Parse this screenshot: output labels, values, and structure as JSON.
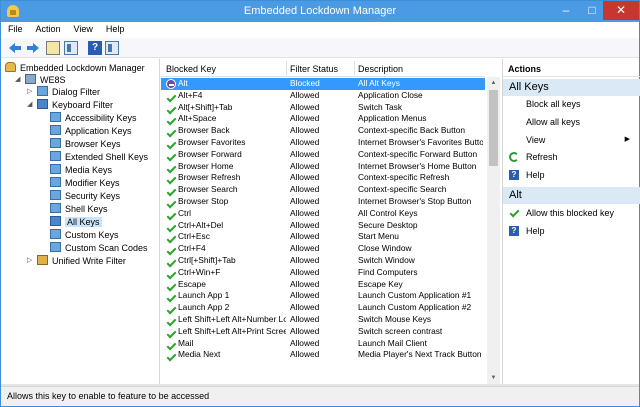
{
  "window": {
    "title": "Embedded Lockdown Manager",
    "controls": {
      "minimize": "–",
      "maximize": "□",
      "close": "✕"
    }
  },
  "menu": [
    "File",
    "Action",
    "View",
    "Help"
  ],
  "toolbar": {
    "icons": [
      "back-arrow-icon",
      "forward-arrow-icon",
      "up-folder-icon",
      "show-hide-tree-icon",
      "help-icon",
      "show-hide-action-pane-icon"
    ],
    "help_glyph": "?"
  },
  "tree": {
    "root": "Embedded Lockdown Manager",
    "device": "WE8S",
    "dialog_filter": "Dialog Filter",
    "keyboard_filter": "Keyboard Filter",
    "keyboard_children": [
      "Accessibility Keys",
      "Application Keys",
      "Browser Keys",
      "Extended Shell Keys",
      "Media Keys",
      "Modifier Keys",
      "Security Keys",
      "Shell Keys",
      "All Keys",
      "Custom Keys",
      "Custom Scan Codes"
    ],
    "selected": "All Keys",
    "uwf": "Unified Write Filter",
    "expander_open": "◢",
    "expander_closed": "▷"
  },
  "list": {
    "columns": [
      "Blocked Key",
      "Filter Status",
      "Description"
    ],
    "rows": [
      {
        "key": "Alt",
        "status": "Blocked",
        "desc": "All Alt Keys",
        "blocked": true
      },
      {
        "key": "Alt+F4",
        "status": "Allowed",
        "desc": "Application Close"
      },
      {
        "key": "Alt[+Shift]+Tab",
        "status": "Allowed",
        "desc": "Switch Task"
      },
      {
        "key": "Alt+Space",
        "status": "Allowed",
        "desc": "Application Menus"
      },
      {
        "key": "Browser Back",
        "status": "Allowed",
        "desc": "Context-specific Back Button"
      },
      {
        "key": "Browser Favorites",
        "status": "Allowed",
        "desc": "Internet Browser's Favorites Button"
      },
      {
        "key": "Browser Forward",
        "status": "Allowed",
        "desc": "Context-specific Forward Button"
      },
      {
        "key": "Browser Home",
        "status": "Allowed",
        "desc": "Internet Browser's Home Button"
      },
      {
        "key": "Browser Refresh",
        "status": "Allowed",
        "desc": "Context-specific Refresh"
      },
      {
        "key": "Browser Search",
        "status": "Allowed",
        "desc": "Context-specific Search"
      },
      {
        "key": "Browser Stop",
        "status": "Allowed",
        "desc": "Internet Browser's Stop Button"
      },
      {
        "key": "Ctrl",
        "status": "Allowed",
        "desc": "All Control Keys"
      },
      {
        "key": "Ctrl+Alt+Del",
        "status": "Allowed",
        "desc": "Secure Desktop"
      },
      {
        "key": "Ctrl+Esc",
        "status": "Allowed",
        "desc": "Start Menu"
      },
      {
        "key": "Ctrl+F4",
        "status": "Allowed",
        "desc": "Close Window"
      },
      {
        "key": "Ctrl[+Shift]+Tab",
        "status": "Allowed",
        "desc": "Switch Window"
      },
      {
        "key": "Ctrl+Win+F",
        "status": "Allowed",
        "desc": "Find Computers"
      },
      {
        "key": "Escape",
        "status": "Allowed",
        "desc": "Escape Key"
      },
      {
        "key": "Launch App 1",
        "status": "Allowed",
        "desc": "Launch Custom Application #1"
      },
      {
        "key": "Launch App 2",
        "status": "Allowed",
        "desc": "Launch Custom Application #2"
      },
      {
        "key": "Left Shift+Left Alt+Number Lo...",
        "status": "Allowed",
        "desc": "Switch Mouse Keys"
      },
      {
        "key": "Left Shift+Left Alt+Print Screen",
        "status": "Allowed",
        "desc": "Switch screen contrast"
      },
      {
        "key": "Mail",
        "status": "Allowed",
        "desc": "Launch Mail Client"
      },
      {
        "key": "Media Next",
        "status": "Allowed",
        "desc": "Media Player's Next Track Button"
      }
    ],
    "selected_index": 0
  },
  "scrollbar": {
    "up": "▲",
    "down": "▼"
  },
  "actions": {
    "header": "Actions",
    "group1": "All Keys",
    "group1_items": [
      "Block all keys",
      "Allow all keys",
      "View",
      "Refresh",
      "Help"
    ],
    "view_arrow": "▶",
    "group2": "Alt",
    "group2_items": [
      "Allow this blocked key",
      "Help"
    ],
    "help_glyph": "?"
  },
  "status": "Allows this key to enable to feature to be accessed"
}
